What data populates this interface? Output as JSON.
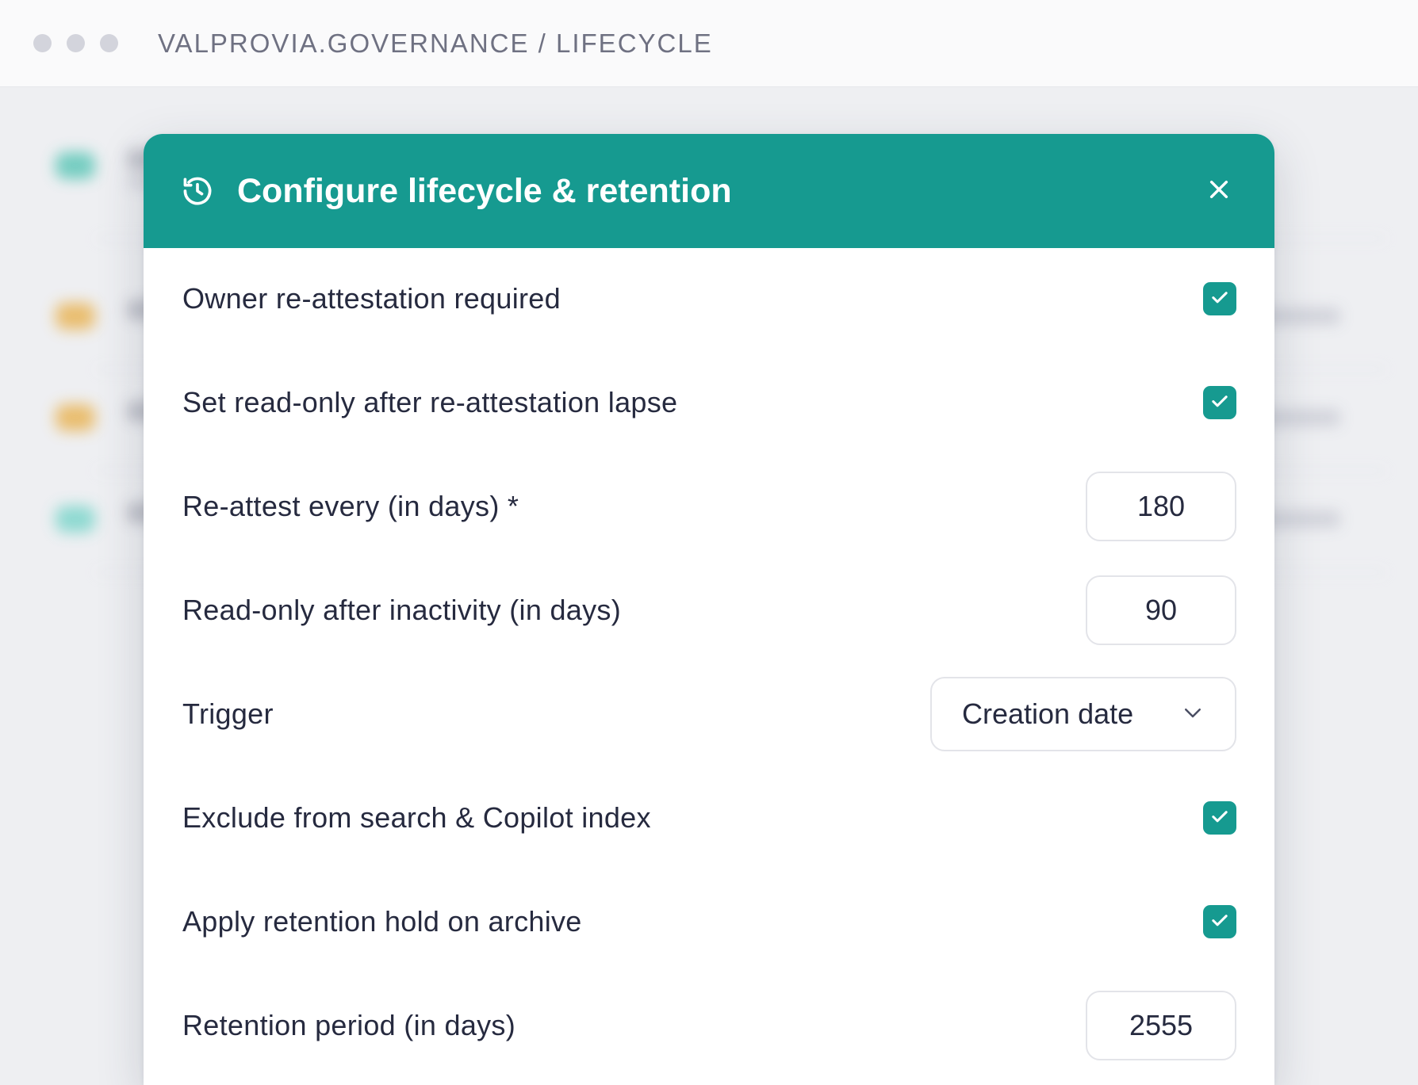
{
  "window": {
    "breadcrumb": "VALPROVIA.GOVERNANCE / LIFECYCLE"
  },
  "modal": {
    "title": "Configure lifecycle & retention",
    "icon": "history-icon",
    "close_icon": "close-icon",
    "header_color": "#169a90",
    "rows": [
      {
        "label": "Owner re-attestation required",
        "type": "checkbox",
        "checked": true
      },
      {
        "label": "Set read-only after re-attestation lapse",
        "type": "checkbox",
        "checked": true
      },
      {
        "label": "Re-attest every (in days) *",
        "type": "number",
        "value": "180"
      },
      {
        "label": "Read-only after inactivity (in days)",
        "type": "number",
        "value": "90"
      },
      {
        "label": "Trigger",
        "type": "select",
        "value": "Creation date"
      },
      {
        "label": "Exclude from search & Copilot index",
        "type": "checkbox",
        "checked": true
      },
      {
        "label": "Apply retention hold on archive",
        "type": "checkbox",
        "checked": true
      },
      {
        "label": "Retention period (in days)",
        "type": "number",
        "value": "2555"
      }
    ]
  }
}
